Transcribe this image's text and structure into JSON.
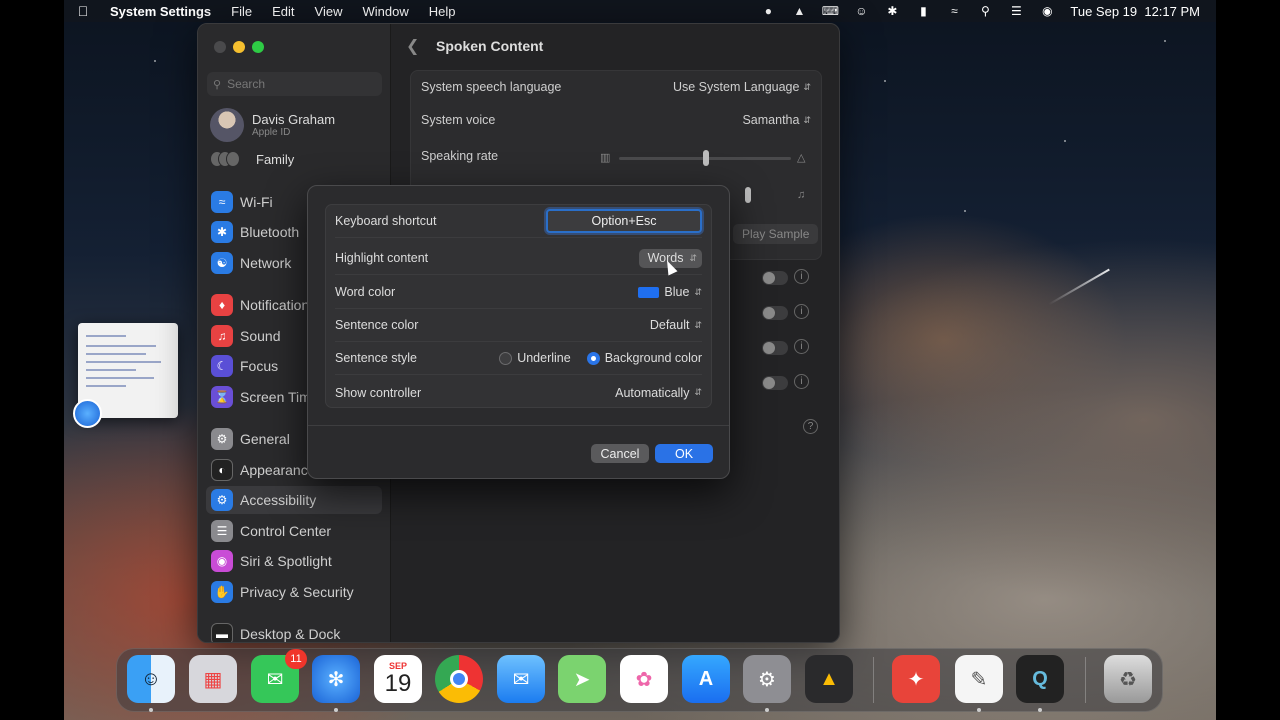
{
  "menubar": {
    "app_name": "System Settings",
    "menus": [
      "File",
      "Edit",
      "View",
      "Window",
      "Help"
    ],
    "datetime": "Tue Sep 19  12:17 PM"
  },
  "sidebar": {
    "search_placeholder": "Search",
    "profile_name": "Davis Graham",
    "profile_sub": "Apple ID",
    "family_label": "Family",
    "items": [
      {
        "label": "Wi-Fi",
        "icon": "wifi-icon",
        "color": "#2a7be4"
      },
      {
        "label": "Bluetooth",
        "icon": "bluetooth-icon",
        "color": "#2a7be4"
      },
      {
        "label": "Network",
        "icon": "globe-icon",
        "color": "#2a7be4"
      },
      {
        "label": "Notifications",
        "icon": "bell-icon",
        "color": "#e84242"
      },
      {
        "label": "Sound",
        "icon": "speaker-icon",
        "color": "#e84242"
      },
      {
        "label": "Focus",
        "icon": "moon-icon",
        "color": "#5a4fd6"
      },
      {
        "label": "Screen Time",
        "icon": "hourglass-icon",
        "color": "#6a4fd6"
      },
      {
        "label": "General",
        "icon": "gear-icon",
        "color": "#8a8a8e"
      },
      {
        "label": "Appearance",
        "icon": "appearance-icon",
        "color": "#222"
      },
      {
        "label": "Accessibility",
        "icon": "accessibility-icon",
        "color": "#2a7be4"
      },
      {
        "label": "Control Center",
        "icon": "control-center-icon",
        "color": "#8a8a8e"
      },
      {
        "label": "Siri & Spotlight",
        "icon": "siri-icon",
        "color": "#c94cd6"
      },
      {
        "label": "Privacy & Security",
        "icon": "hand-icon",
        "color": "#2a7be4"
      },
      {
        "label": "Desktop & Dock",
        "icon": "dock-icon",
        "color": "#222"
      }
    ]
  },
  "content": {
    "title": "Spoken Content",
    "system_speech_language_label": "System speech language",
    "system_speech_language_value": "Use System Language",
    "system_voice_label": "System voice",
    "system_voice_value": "Samantha",
    "speaking_rate_label": "Speaking rate",
    "play_sample_label": "Play Sample",
    "help_label": "?"
  },
  "sheet": {
    "keyboard_shortcut_label": "Keyboard shortcut",
    "keyboard_shortcut_value": "Option+Esc",
    "highlight_content_label": "Highlight content",
    "highlight_content_value": "Words",
    "word_color_label": "Word color",
    "word_color_value": "Blue",
    "word_color_swatch": "#1f6ff0",
    "sentence_color_label": "Sentence color",
    "sentence_color_value": "Default",
    "sentence_style_label": "Sentence style",
    "sentence_style_options": [
      "Underline",
      "Background color"
    ],
    "sentence_style_selected": "Background color",
    "show_controller_label": "Show controller",
    "show_controller_value": "Automatically",
    "cancel_label": "Cancel",
    "ok_label": "OK"
  },
  "dock": {
    "calendar_month": "SEP",
    "calendar_day": "19",
    "messages_badge": "11"
  }
}
